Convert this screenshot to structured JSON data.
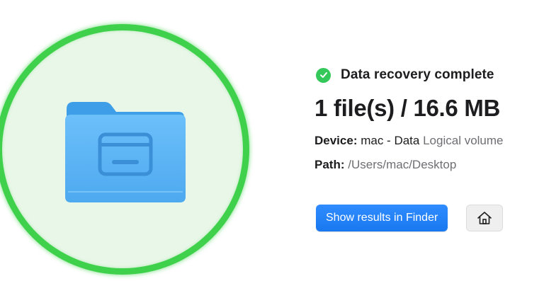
{
  "status": {
    "icon": "checkmark-circle-icon",
    "text": "Data recovery complete",
    "color": "#34c759"
  },
  "result": {
    "summary": "1 file(s) / 16.6 MB"
  },
  "device": {
    "label": "Device:",
    "name": "mac - Data",
    "type": "Logical volume"
  },
  "path": {
    "label": "Path:",
    "value": "/Users/mac/Desktop"
  },
  "actions": {
    "show_results_label": "Show results in Finder",
    "home_icon": "home-icon"
  },
  "illustration": {
    "icon": "folder-icon",
    "ring_color": "#3fd14c",
    "folder_color": "#5ab4f5"
  }
}
